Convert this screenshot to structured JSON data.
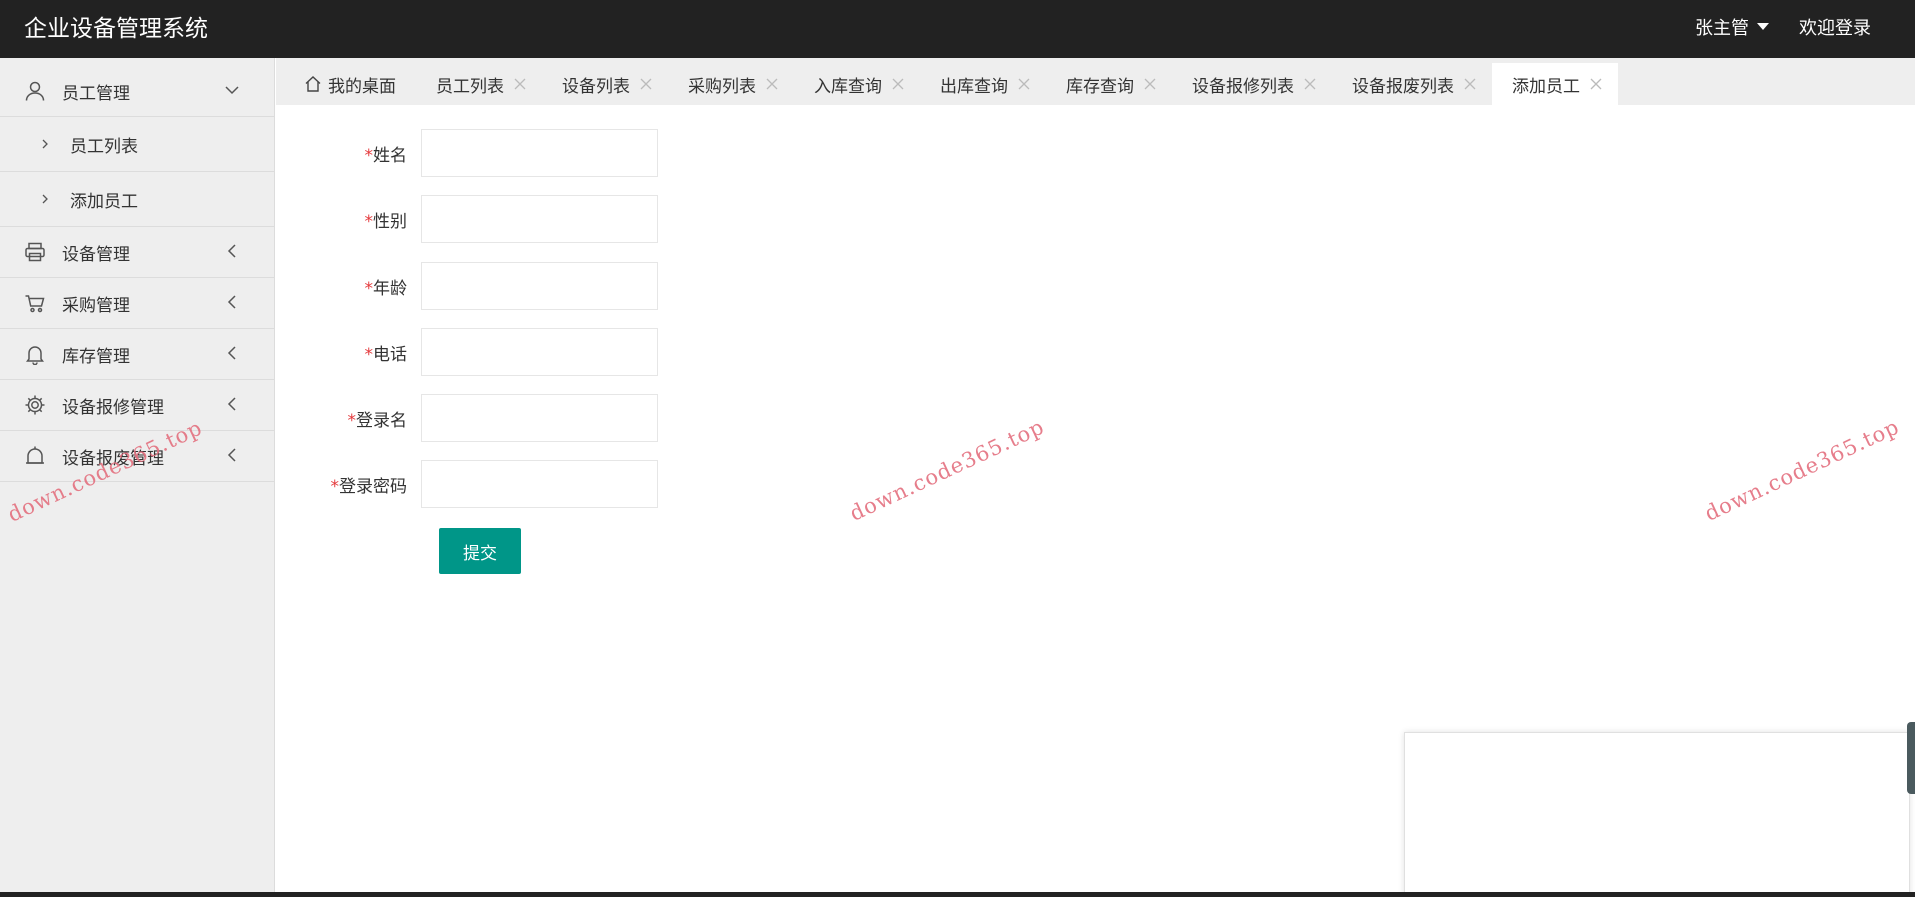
{
  "header": {
    "title": "企业设备管理系统",
    "user_name": "张主管",
    "welcome": "欢迎登录"
  },
  "sidebar": {
    "groups": [
      {
        "label": "员工管理",
        "icon": "user-icon",
        "expanded": true,
        "children": [
          {
            "label": "员工列表"
          },
          {
            "label": "添加员工"
          }
        ]
      },
      {
        "label": "设备管理",
        "icon": "printer-icon",
        "expanded": false
      },
      {
        "label": "采购管理",
        "icon": "cart-icon",
        "expanded": false
      },
      {
        "label": "库存管理",
        "icon": "bell-icon",
        "expanded": false
      },
      {
        "label": "设备报修管理",
        "icon": "gear-icon",
        "expanded": false
      },
      {
        "label": "设备报废管理",
        "icon": "alert-icon",
        "expanded": false
      }
    ]
  },
  "tabs": [
    {
      "label": "我的桌面",
      "closable": false,
      "icon": "home-icon"
    },
    {
      "label": "员工列表",
      "closable": true
    },
    {
      "label": "设备列表",
      "closable": true
    },
    {
      "label": "采购列表",
      "closable": true
    },
    {
      "label": "入库查询",
      "closable": true
    },
    {
      "label": "出库查询",
      "closable": true
    },
    {
      "label": "库存查询",
      "closable": true
    },
    {
      "label": "设备报修列表",
      "closable": true
    },
    {
      "label": "设备报废列表",
      "closable": true
    },
    {
      "label": "添加员工",
      "closable": true,
      "active": true
    }
  ],
  "form": {
    "required_mark": "*",
    "fields": [
      {
        "label": "姓名",
        "value": ""
      },
      {
        "label": "性别",
        "value": ""
      },
      {
        "label": "年龄",
        "value": ""
      },
      {
        "label": "电话",
        "value": ""
      },
      {
        "label": "登录名",
        "value": ""
      },
      {
        "label": "登录密码",
        "value": ""
      }
    ],
    "submit_label": "提交"
  },
  "watermark": "down.code365.top",
  "colors": {
    "header_bg": "#222222",
    "sidebar_bg": "#eeeeee",
    "primary_button": "#009688",
    "required": "#e4393c",
    "watermark": "#e4707f"
  }
}
